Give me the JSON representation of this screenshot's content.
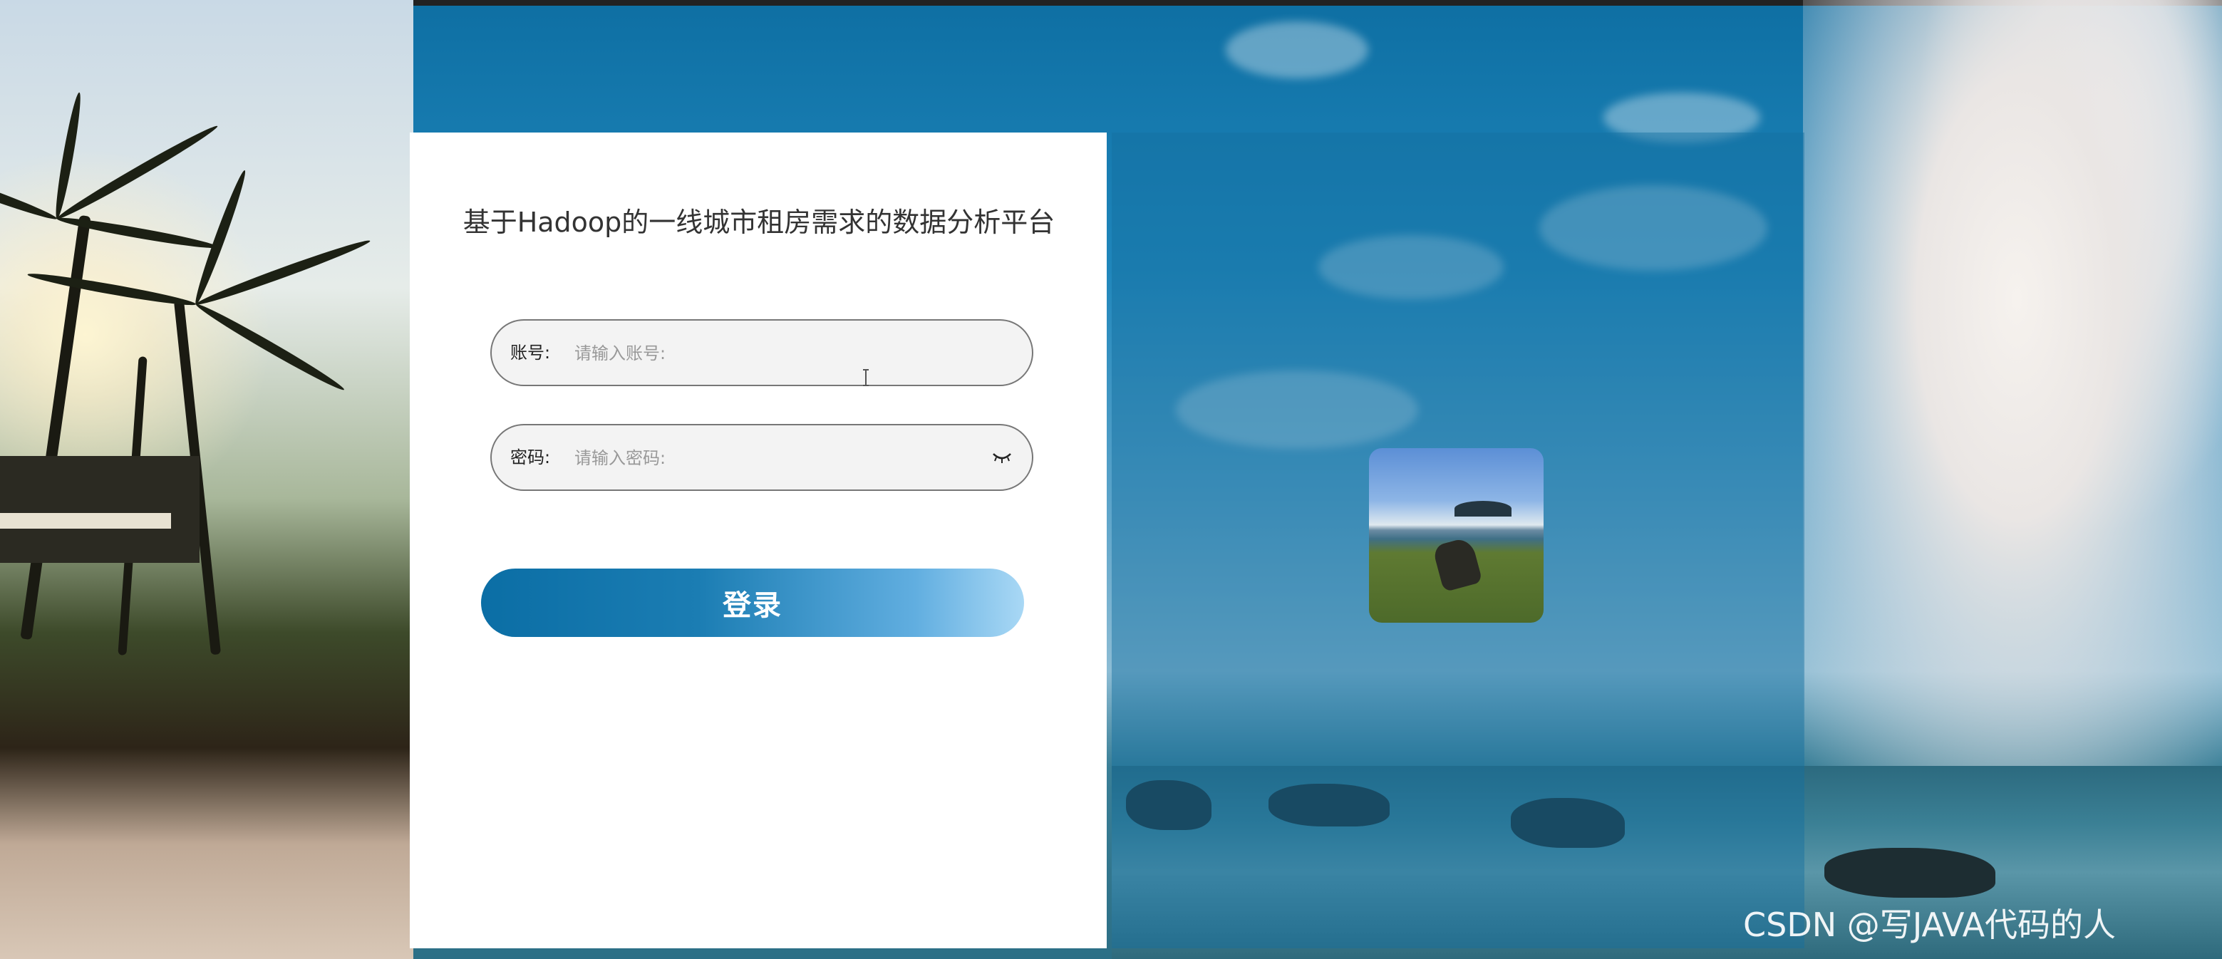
{
  "title": "基于Hadoop的一线城市租房需求的数据分析平台",
  "login": {
    "account_label": "账号:",
    "account_placeholder": "请输入账号:",
    "password_label": "密码:",
    "password_placeholder": "请输入密码:",
    "submit_label": "登录"
  },
  "watermark": "CSDN @写JAVA代码的人",
  "colors": {
    "button_start": "#0b6ea5",
    "button_end": "#a9d8f5",
    "panel_overlay": "rgba(20,110,160,0.45)"
  },
  "icons": {
    "password_toggle": "eye-closed-icon",
    "preview": "avatar-image"
  }
}
